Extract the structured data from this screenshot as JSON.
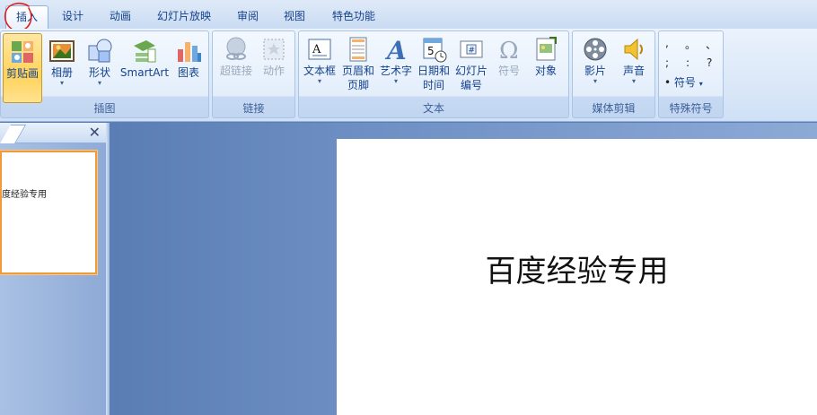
{
  "tabs": [
    {
      "label": "插入",
      "active": true
    },
    {
      "label": "设计"
    },
    {
      "label": "动画"
    },
    {
      "label": "幻灯片放映"
    },
    {
      "label": "审阅"
    },
    {
      "label": "视图"
    },
    {
      "label": "特色功能"
    }
  ],
  "groups": {
    "illustrations": {
      "label": "插图",
      "buttons": [
        {
          "label": "剪贴画",
          "icon": "clipart-icon",
          "selected": true
        },
        {
          "label": "相册",
          "icon": "photo-album-icon",
          "dropdown": true
        },
        {
          "label": "形状",
          "icon": "shapes-icon",
          "dropdown": true
        },
        {
          "label": "SmartArt",
          "icon": "smartart-icon"
        },
        {
          "label": "图表",
          "icon": "chart-icon"
        }
      ]
    },
    "links": {
      "label": "链接",
      "buttons": [
        {
          "label": "超链接",
          "icon": "hyperlink-icon",
          "disabled": true
        },
        {
          "label": "动作",
          "icon": "action-icon",
          "disabled": true
        }
      ]
    },
    "text": {
      "label": "文本",
      "buttons": [
        {
          "label": "文本框",
          "icon": "textbox-icon",
          "dropdown": true
        },
        {
          "label": "页眉和",
          "label2": "页脚",
          "icon": "header-footer-icon"
        },
        {
          "label": "艺术字",
          "icon": "wordart-icon",
          "dropdown": true
        },
        {
          "label": "日期和",
          "label2": "时间",
          "icon": "date-time-icon"
        },
        {
          "label": "幻灯片",
          "label2": "编号",
          "icon": "slide-number-icon"
        },
        {
          "label": "符号",
          "icon": "omega-icon",
          "disabled": true
        },
        {
          "label": "对象",
          "icon": "object-icon"
        }
      ]
    },
    "media": {
      "label": "媒体剪辑",
      "buttons": [
        {
          "label": "影片",
          "icon": "film-reel-icon",
          "dropdown": true
        },
        {
          "label": "声音",
          "icon": "speaker-icon",
          "dropdown": true
        }
      ]
    },
    "special": {
      "label": "特殊符号",
      "symbols": [
        ",",
        "。",
        "、",
        ";",
        ":",
        "?"
      ],
      "symbol_button": {
        "label": "符号",
        "bullet": "•"
      }
    }
  },
  "panel": {
    "close_glyph": "✕",
    "thumb_text": "度经验专用"
  },
  "slide": {
    "title": "百度经验专用"
  },
  "colors": {
    "accent": "#15428b",
    "annotation": "#e02020",
    "selected_thumb_border": "#f29a38"
  }
}
